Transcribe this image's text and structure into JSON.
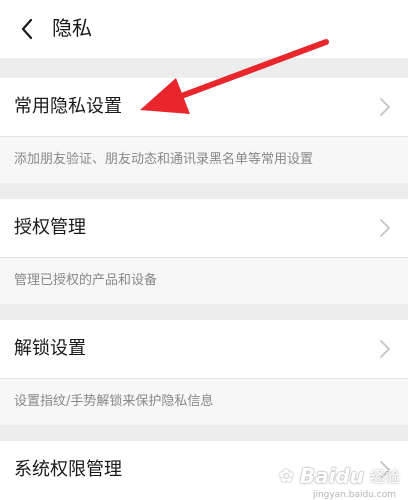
{
  "header": {
    "title": "隐私",
    "back_icon": "chevron-left-icon"
  },
  "settings": {
    "items": [
      {
        "label": "常用隐私设置",
        "description": "添加朋友验证、朋友动态和通讯录黑名单等常用设置"
      },
      {
        "label": "授权管理",
        "description": "管理已授权的产品和设备"
      },
      {
        "label": "解锁设置",
        "description": "设置指纹/手势解锁来保护隐私信息"
      },
      {
        "label": "系统权限管理",
        "description": ""
      }
    ]
  },
  "annotation": {
    "arrow_color": "#e8262c"
  },
  "watermark": {
    "brand": "Baidu",
    "brand_sub": "经验",
    "url": "jingyan.baidu.com"
  },
  "colors": {
    "background": "#ededed",
    "row": "#ffffff",
    "description_bg": "#f7f7f7",
    "text": "#1a1a1a",
    "secondary_text": "#888888",
    "chevron": "#c4c4c4"
  }
}
